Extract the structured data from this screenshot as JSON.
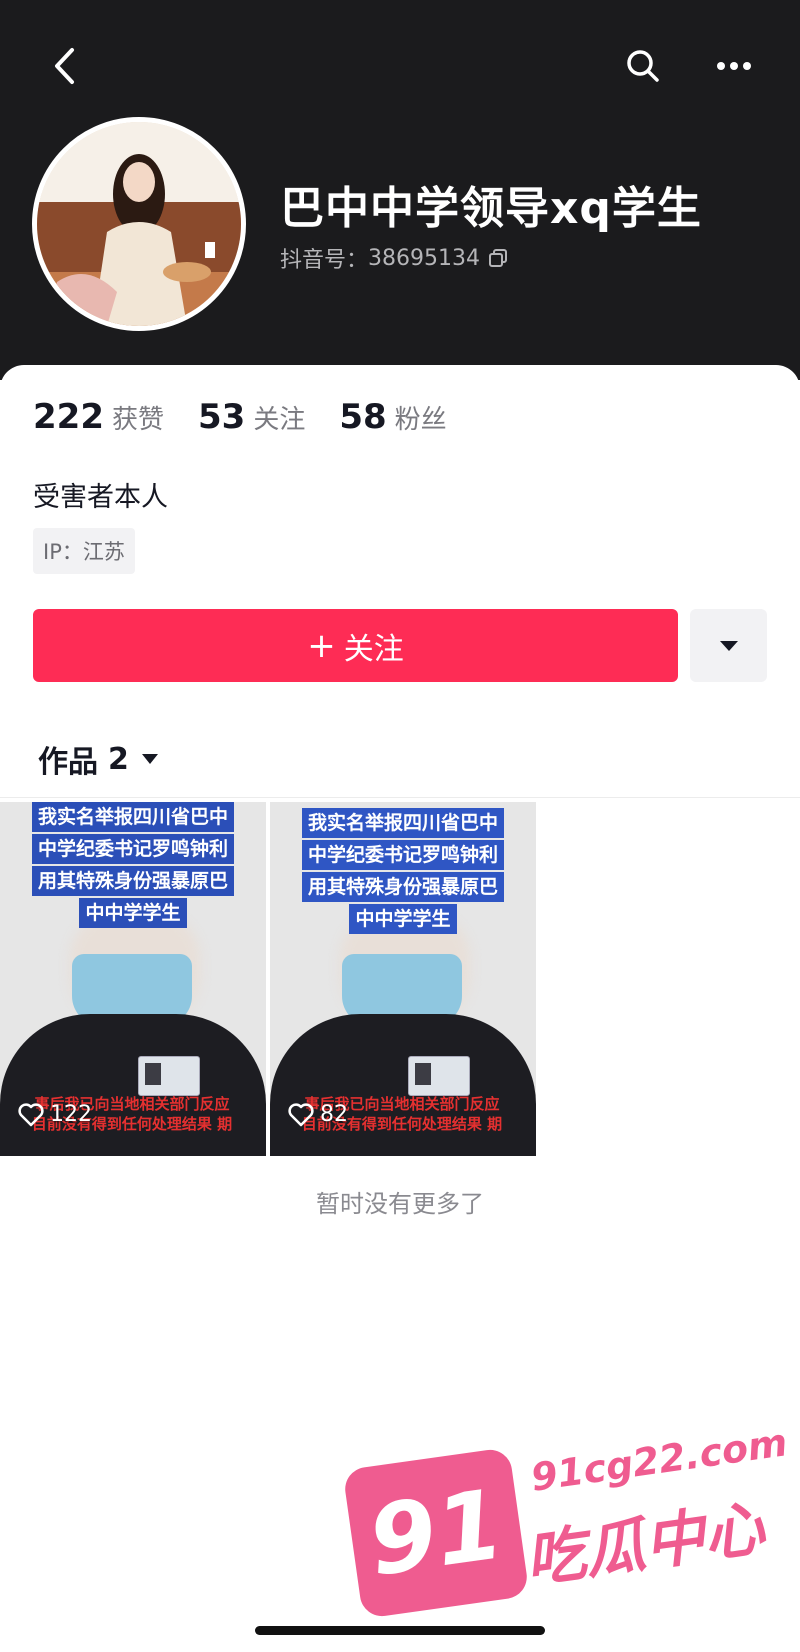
{
  "header": {
    "nickname": "巴中中学领导xq学生",
    "douyin_id_label": "抖音号：",
    "douyin_id": "38695134"
  },
  "stats": [
    {
      "value": "222",
      "label": "获赞"
    },
    {
      "value": "53",
      "label": "关注"
    },
    {
      "value": "58",
      "label": "粉丝"
    }
  ],
  "bio": "受害者本人",
  "ip_tag": "IP：江苏",
  "follow_button": {
    "plus": "+",
    "label": "关注"
  },
  "works_tab": {
    "label": "作品",
    "count": "2"
  },
  "videos": [
    {
      "caption_lines": [
        "我实名举报四川省巴中",
        "中学纪委书记罗鸣钟利",
        "用其特殊身份强暴原巴",
        "中中学学生"
      ],
      "bottom_text": "事后我已向当地相关部门反应",
      "bottom_text_2": "目前没有得到任何处理结果 期",
      "likes": "122"
    },
    {
      "caption_lines": [
        "我实名举报四川省巴中",
        "中学纪委书记罗鸣钟利",
        "用其特殊身份强暴原巴",
        "中中学学生"
      ],
      "bottom_text": "事后我已向当地相关部门反应",
      "bottom_text_2": "目前没有得到任何处理结果 期",
      "likes": "82"
    }
  ],
  "no_more": "暂时没有更多了",
  "watermark": {
    "badge": "91",
    "url": "91cg22.com",
    "name": "吃瓜中心"
  },
  "colors": {
    "header_bg": "#1b1b1d",
    "follow_button": "#fe2c55",
    "watermark": "#ef5c90"
  }
}
